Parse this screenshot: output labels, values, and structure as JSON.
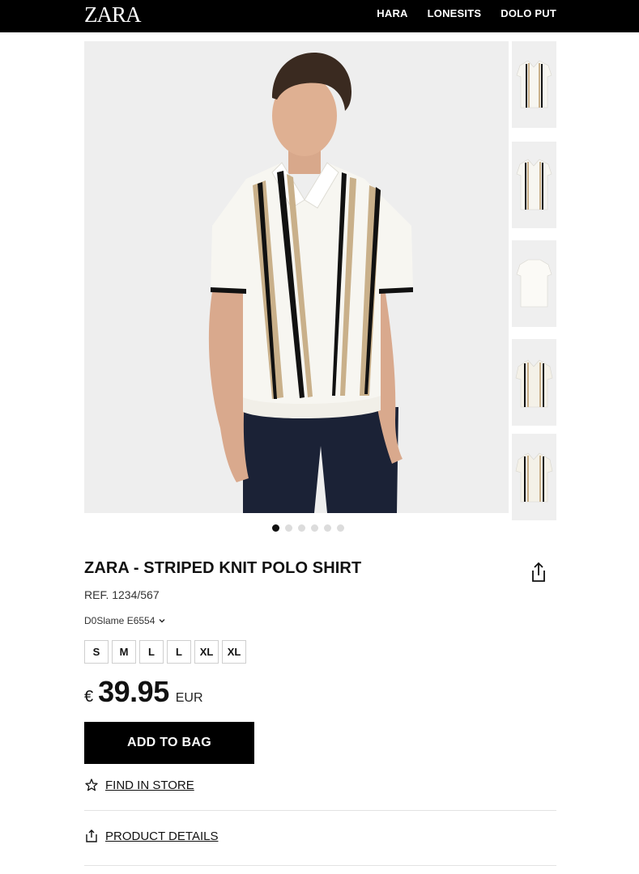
{
  "header": {
    "logo": "ZARA",
    "nav": [
      "HARA",
      "LONESITS",
      "DOLO PUT"
    ]
  },
  "gallery": {
    "main_image": "model-wearing-striped-knit-polo",
    "thumbnails": [
      "polo-front-thumbnail",
      "polo-front-thumbnail",
      "polo-back-thumbnail",
      "polo-flat-thumbnail",
      "polo-flat-thumbnail"
    ],
    "dot_count": 6,
    "active_dot": 0
  },
  "product": {
    "title": "ZARA - STRIPED KNIT POLO SHIRT",
    "ref": "REF. 1234/567",
    "color_label": "D0Slame E6554",
    "sizes": [
      "S",
      "M",
      "L",
      "L",
      "XL",
      "XL"
    ],
    "price_currency_symbol": "€",
    "price_amount": "39.95",
    "price_currency_code": "EUR"
  },
  "actions": {
    "add_to_bag": "ADD TO BAG",
    "find_in_store": "FIND IN STORE",
    "product_details": "PRODUCT DETAILS"
  },
  "colors": {
    "header_bg": "#000000",
    "button_bg": "#000000",
    "stripe_black": "#111111",
    "stripe_tan": "#c9b08a",
    "polo_white": "#f7f6f1",
    "trousers_navy": "#1b2236"
  }
}
